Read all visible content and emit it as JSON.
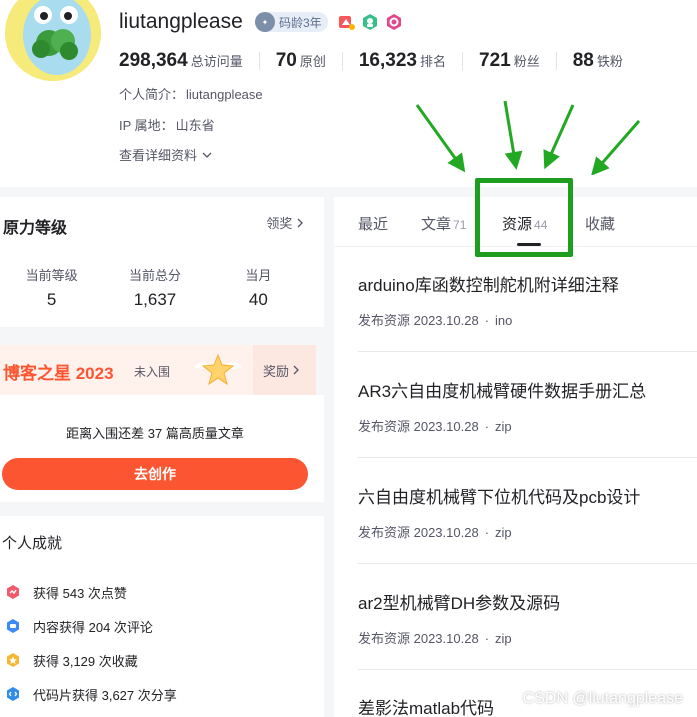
{
  "profile": {
    "username": "liutangplease",
    "code_age": "码龄3年",
    "stats": [
      {
        "value": "298,364",
        "label": "总访问量"
      },
      {
        "value": "70",
        "label": "原创"
      },
      {
        "value": "16,323",
        "label": "排名"
      },
      {
        "value": "721",
        "label": "粉丝"
      },
      {
        "value": "88",
        "label": "铁粉"
      }
    ],
    "bio_label": "个人简介：",
    "bio_value": "liutangplease",
    "ip_label": "IP 属地：",
    "ip_value": "山东省",
    "more_info": "查看详细资料"
  },
  "level": {
    "title": "原力等级",
    "link": "领奖",
    "cols": [
      {
        "label": "当前等级",
        "value": "5"
      },
      {
        "label": "当前总分",
        "value": "1,637"
      },
      {
        "label": "当月",
        "value": "40"
      }
    ]
  },
  "star": {
    "title": "博客之星 2023",
    "status": "未入围",
    "reward": "奖励"
  },
  "create": {
    "gap_text": "距离入围还差 37 篇高质量文章",
    "button": "去创作"
  },
  "achievements": {
    "title": "个人成就",
    "items": [
      {
        "text": "获得 543 次点赞",
        "icon": "thumb-icon",
        "color": "#f25a6b"
      },
      {
        "text": "内容获得 204 次评论",
        "icon": "comment-icon",
        "color": "#3d8af7"
      },
      {
        "text": "获得 3,129 次收藏",
        "icon": "favorite-icon",
        "color": "#f5b731"
      },
      {
        "text": "代码片获得 3,627 次分享",
        "icon": "code-share-icon",
        "color": "#2f8ee8"
      }
    ]
  },
  "tabs": [
    {
      "label": "最近",
      "count": ""
    },
    {
      "label": "文章",
      "count": "71"
    },
    {
      "label": "资源",
      "count": "44"
    },
    {
      "label": "收藏",
      "count": ""
    }
  ],
  "resources": [
    {
      "title": "arduino库函数控制舵机附详细注释",
      "meta": "发布资源 2023.10.28",
      "type": "ino"
    },
    {
      "title": "AR3六自由度机械臂硬件数据手册汇总",
      "meta": "发布资源 2023.10.28",
      "type": "zip"
    },
    {
      "title": "六自由度机械臂下位机代码及pcb设计",
      "meta": "发布资源 2023.10.28",
      "type": "zip"
    },
    {
      "title": "ar2型机械臂DH参数及源码",
      "meta": "发布资源 2023.10.28",
      "type": "zip"
    },
    {
      "title": "差影法matlab代码",
      "meta": "",
      "type": ""
    }
  ],
  "watermark": "CSDN @liutangplease",
  "colors": {
    "accent": "#fc5531",
    "highlight": "#1e9e1e"
  }
}
